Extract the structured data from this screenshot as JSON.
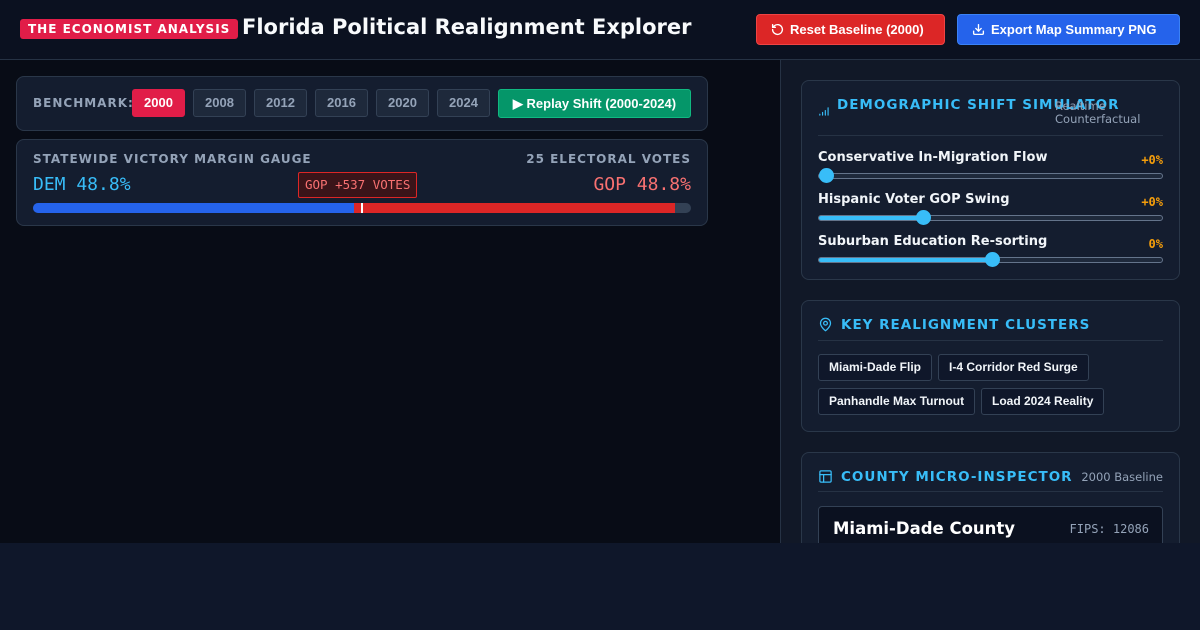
{
  "header": {
    "badge": "THE ECONOMIST ANALYSIS",
    "title": "Florida Political Realignment Explorer",
    "reset_label": "Reset Baseline (2000)",
    "export_label": "Export Map Summary PNG"
  },
  "benchmark": {
    "label": "BENCHMARK:",
    "years": [
      "2000",
      "2008",
      "2012",
      "2016",
      "2020",
      "2024"
    ],
    "active_year": "2000",
    "replay_label": "▶ Replay Shift (2000-2024)"
  },
  "gauge": {
    "title": "STATEWIDE VICTORY MARGIN GAUGE",
    "electoral_votes": "25 ELECTORAL VOTES",
    "dem_label": "DEM 48.8%",
    "gop_label": "GOP 48.8%",
    "lead_label": "GOP +537 VOTES",
    "dem_share": 48.8,
    "gop_share": 48.8
  },
  "simulator": {
    "title": "DEMOGRAPHIC SHIFT SIMULATOR",
    "subtitle": "Realtime Counterfactual",
    "sliders": [
      {
        "label": "Conservative In-Migration Flow",
        "value_text": "+0%",
        "position": 0.0
      },
      {
        "label": "Hispanic Voter GOP Swing",
        "value_text": "+0%",
        "position": 0.3
      },
      {
        "label": "Suburban Education Re-sorting",
        "value_text": "0%",
        "position": 0.5
      }
    ]
  },
  "clusters": {
    "title": "KEY REALIGNMENT CLUSTERS",
    "items": [
      "Miami-Dade Flip",
      "I-4 Corridor Red Surge",
      "Panhandle Max Turnout",
      "Load 2024 Reality"
    ]
  },
  "inspector": {
    "title": "COUNTY MICRO-INSPECTOR",
    "subtitle": "2000 Baseline",
    "county_name": "Miami-Dade County",
    "fips": "FIPS: 12086"
  },
  "colors": {
    "accent": "#38bdf8",
    "dem": "#2563eb",
    "gop": "#dc2626",
    "active_year": "#e11d48",
    "replay": "#059669",
    "slider_value": "#f59e0b"
  }
}
